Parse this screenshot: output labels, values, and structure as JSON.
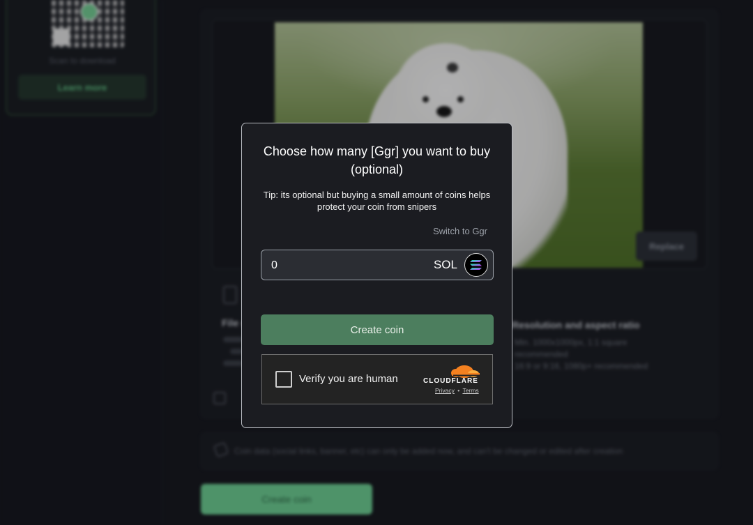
{
  "background": {
    "promo": {
      "scan_text": "Scan to download",
      "learn_more": "Learn more"
    },
    "replace_button": "Replace",
    "file_section": {
      "heading": "File size and type"
    },
    "right_section": {
      "heading": "Resolution and aspect ratio",
      "line1": "Min. 1000x1000px, 1:1 square",
      "line2": "recommended",
      "line3": "16:9 or 9:16, 1080p+ recommended"
    },
    "notice": "Coin data (social links, banner, etc) can only be added now, and can't be changed or edited after creation",
    "create_coin_bottom": "Create coin"
  },
  "modal": {
    "title": "Choose how many [Ggr] you want to buy (optional)",
    "tip": "Tip: its optional but buying a small amount of coins helps protect your coin from snipers",
    "switch_link": "Switch to Ggr",
    "amount_value": "0",
    "currency": "SOL",
    "create_button": "Create coin",
    "captcha": {
      "label": "Verify you are human",
      "brand": "CLOUDFLARE",
      "privacy": "Privacy",
      "separator": "•",
      "terms": "Terms"
    }
  },
  "colors": {
    "accent_green": "#6fd596",
    "modal_button": "#4c7e5e",
    "cloudflare_orange": "#f48120"
  },
  "icons": [
    "qr-code-icon",
    "file-icon",
    "gallery-icon",
    "pencil-icon",
    "solana-icon",
    "cloudflare-icon"
  ]
}
